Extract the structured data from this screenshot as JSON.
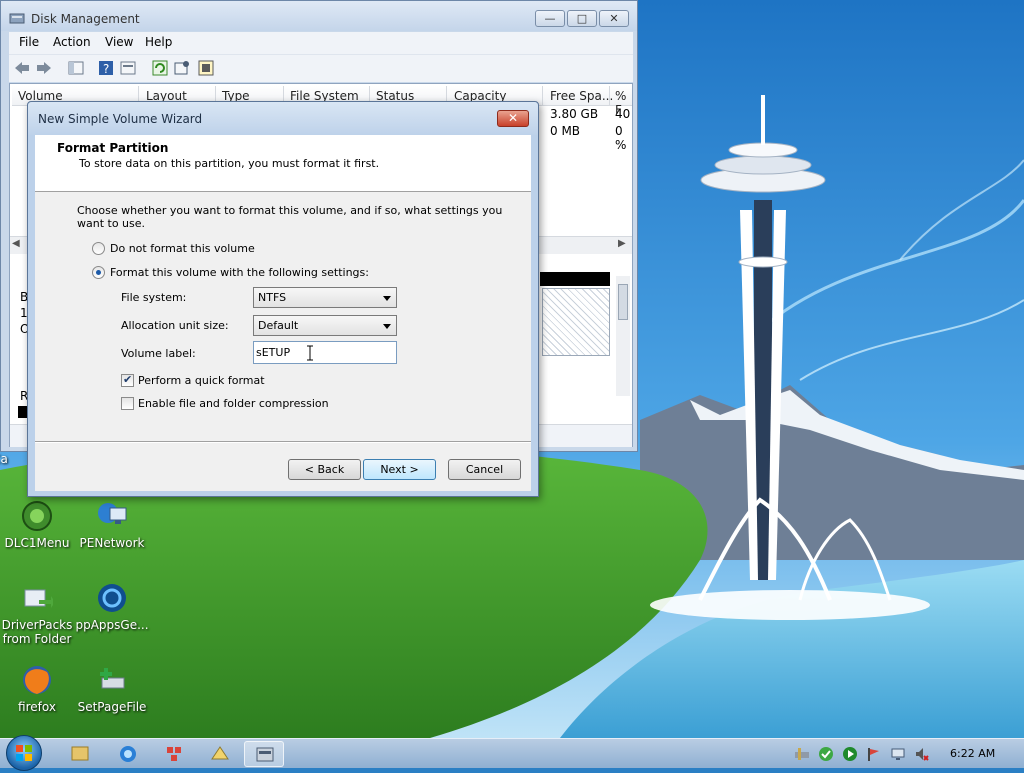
{
  "disk_management": {
    "title": "Disk Management",
    "menu": [
      "File",
      "Action",
      "View",
      "Help"
    ],
    "columns": [
      "Volume",
      "Layout",
      "Type",
      "File System",
      "Status",
      "Capacity",
      "Free Spa...",
      "% F"
    ],
    "rows": [
      {
        "free_space": "3.80 GB",
        "pct_free": "40"
      },
      {
        "free_space": "0 MB",
        "pct_free": "0 %"
      }
    ],
    "lower_left_text": [
      "B",
      "1(",
      "O"
    ],
    "legend_left_text": "R"
  },
  "wizard": {
    "title": "New Simple Volume Wizard",
    "heading": "Format Partition",
    "subheading": "To store data on this partition, you must format it first.",
    "instruction": "Choose whether you want to format this volume, and if so, what settings you want to use.",
    "option_no_format": "Do not format this volume",
    "option_format": "Format this volume with the following settings:",
    "file_system_label": "File system:",
    "file_system_value": "NTFS",
    "allocation_label": "Allocation unit size:",
    "allocation_value": "Default",
    "volume_label_label": "Volume label:",
    "volume_label_value": "sETUP",
    "quick_format_label": "Perform a quick format",
    "quick_format_checked": true,
    "compression_label": "Enable file and folder compression",
    "compression_checked": false,
    "back_label": "< Back",
    "next_label": "Next >",
    "cancel_label": "Cancel"
  },
  "desktop": {
    "partial_icon_label": "Ca",
    "icons": [
      {
        "label": "DLC1Menu",
        "icon": "dlc-menu-icon"
      },
      {
        "label": "PENetwork",
        "icon": "network-icon"
      },
      {
        "label": "DriverPacks from Folder",
        "icon": "driverpacks-icon"
      },
      {
        "label": "ppAppsGe...",
        "icon": "ppapps-icon"
      },
      {
        "label": "firefox",
        "icon": "firefox-icon"
      },
      {
        "label": "SetPageFile",
        "icon": "setpagefile-icon"
      }
    ]
  },
  "taskbar": {
    "clock": "6:22 AM"
  },
  "colors": {
    "sky": "#3a8fd6",
    "grass": "#3c9a2c",
    "water": "#6cc3e8"
  }
}
